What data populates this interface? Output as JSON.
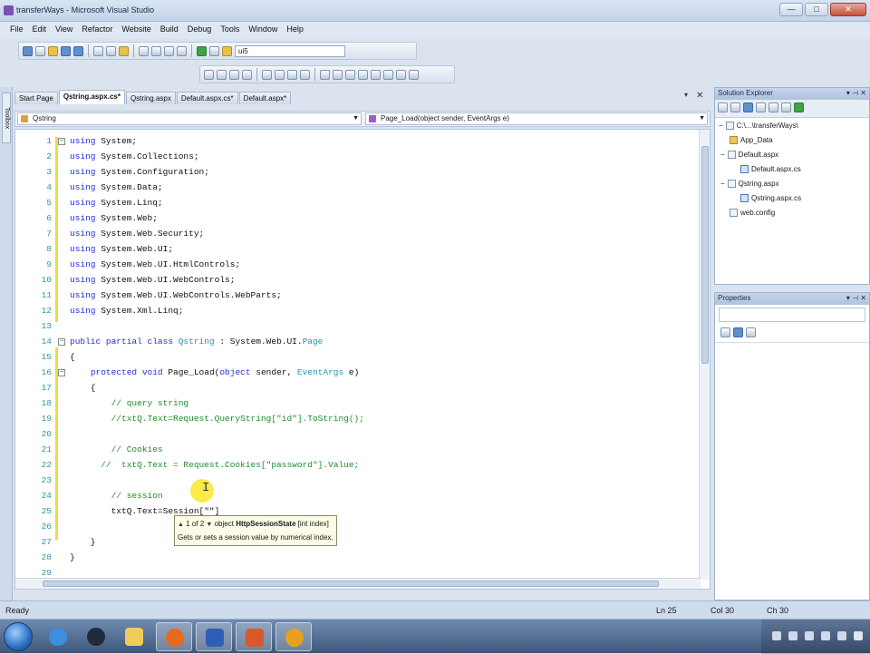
{
  "window": {
    "title": "transferWays - Microsoft Visual Studio",
    "min": "—",
    "max": "□",
    "close": "✕"
  },
  "menu": [
    "File",
    "Edit",
    "View",
    "Refactor",
    "Website",
    "Build",
    "Debug",
    "Tools",
    "Window",
    "Help"
  ],
  "toolbar": {
    "config_value": "ui5"
  },
  "toolbox": {
    "label": "Toolbox"
  },
  "tabs": [
    "Start Page",
    "Qstring.aspx.cs*",
    "Qstring.aspx",
    "Default.aspx.cs*",
    "Default.aspx*"
  ],
  "nav": {
    "class_combo": "Qstring",
    "member_combo": "Page_Load(object sender, EventArgs e)"
  },
  "code": [
    {
      "n": "1",
      "text": "using System;"
    },
    {
      "n": "2",
      "text": "using System.Collections;"
    },
    {
      "n": "3",
      "text": "using System.Configuration;"
    },
    {
      "n": "4",
      "text": "using System.Data;"
    },
    {
      "n": "5",
      "text": "using System.Linq;"
    },
    {
      "n": "6",
      "text": "using System.Web;"
    },
    {
      "n": "7",
      "text": "using System.Web.Security;"
    },
    {
      "n": "8",
      "text": "using System.Web.UI;"
    },
    {
      "n": "9",
      "text": "using System.Web.UI.HtmlControls;"
    },
    {
      "n": "10",
      "text": "using System.Web.UI.WebControls;"
    },
    {
      "n": "11",
      "text": "using System.Web.UI.WebControls.WebParts;"
    },
    {
      "n": "12",
      "text": "using System.Xml.Linq;"
    },
    {
      "n": "13",
      "text": ""
    },
    {
      "n": "14",
      "text": "public partial class Qstring : System.Web.UI.Page"
    },
    {
      "n": "15",
      "text": "{"
    },
    {
      "n": "16",
      "text": "    protected void Page_Load(object sender, EventArgs e)"
    },
    {
      "n": "17",
      "text": "    {"
    },
    {
      "n": "18",
      "text": "        // query string"
    },
    {
      "n": "19",
      "text": "        //txtQ.Text=Request.QueryString[\"id\"].ToString();"
    },
    {
      "n": "20",
      "text": ""
    },
    {
      "n": "21",
      "text": "        // Cookies"
    },
    {
      "n": "22",
      "text": "      //  txtQ.Text = Request.Cookies[\"password\"].Value;"
    },
    {
      "n": "23",
      "text": ""
    },
    {
      "n": "24",
      "text": "        // session"
    },
    {
      "n": "25",
      "text": "        txtQ.Text=Session[\"\"]"
    },
    {
      "n": "26",
      "text": ""
    },
    {
      "n": "27",
      "text": "    }"
    },
    {
      "n": "28",
      "text": "}"
    },
    {
      "n": "29",
      "text": ""
    }
  ],
  "tooltip": {
    "counter": "1 of 2",
    "signature_prefix": "object",
    "signature_bold": "HttpSessionState",
    "signature_suffix": "[int index]",
    "description": "Gets or sets a session value by numerical index."
  },
  "solution_explorer": {
    "title": "Solution Explorer",
    "nodes": [
      "C:\\...\\transferWays\\",
      "App_Data",
      "Default.aspx",
      "Default.aspx.cs",
      "Qstring.aspx",
      "Qstring.aspx.cs",
      "web.config"
    ]
  },
  "properties": {
    "title": "Properties"
  },
  "status": {
    "left": "Ready",
    "ln": "Ln 25",
    "col": "Col 30",
    "ch": "Ch 30"
  }
}
